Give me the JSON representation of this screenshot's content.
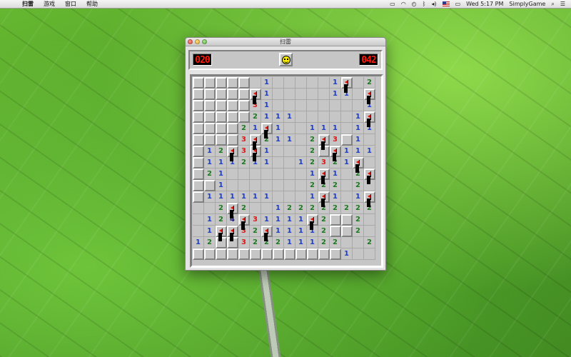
{
  "menubar": {
    "app_name": "扫雷",
    "menus": [
      "游戏",
      "窗口",
      "帮助"
    ],
    "clock": "Wed 5:17 PM",
    "user": "SimplyGame"
  },
  "window": {
    "title": "扫雷"
  },
  "game": {
    "mine_counter": "020",
    "timer": "042",
    "face": "smiley"
  },
  "board": {
    "rows": [
      "hhhhho1ooooo1fo2f",
      "hhhhhf1ooooo11of",
      "hhhhh31oooooooo1",
      "hhhhh2111ooooo1f",
      "hhhh21f1oo111o11",
      "hhhh3f211o2f3h1o",
      "h12f3f1ooo2hf111",
      "h111211oo12321f",
      "h21ooooooo1f1o2f",
      "hh1ooooooo222o2",
      "h111111ooo1f1o1f",
      "oo2f2oo1222222221",
      "o124f31111f2hh2o",
      "o1ff32f11112hh2o",
      "12hh322211122oo2",
      "hhhhhhhhhhhhh1oo"
    ]
  }
}
